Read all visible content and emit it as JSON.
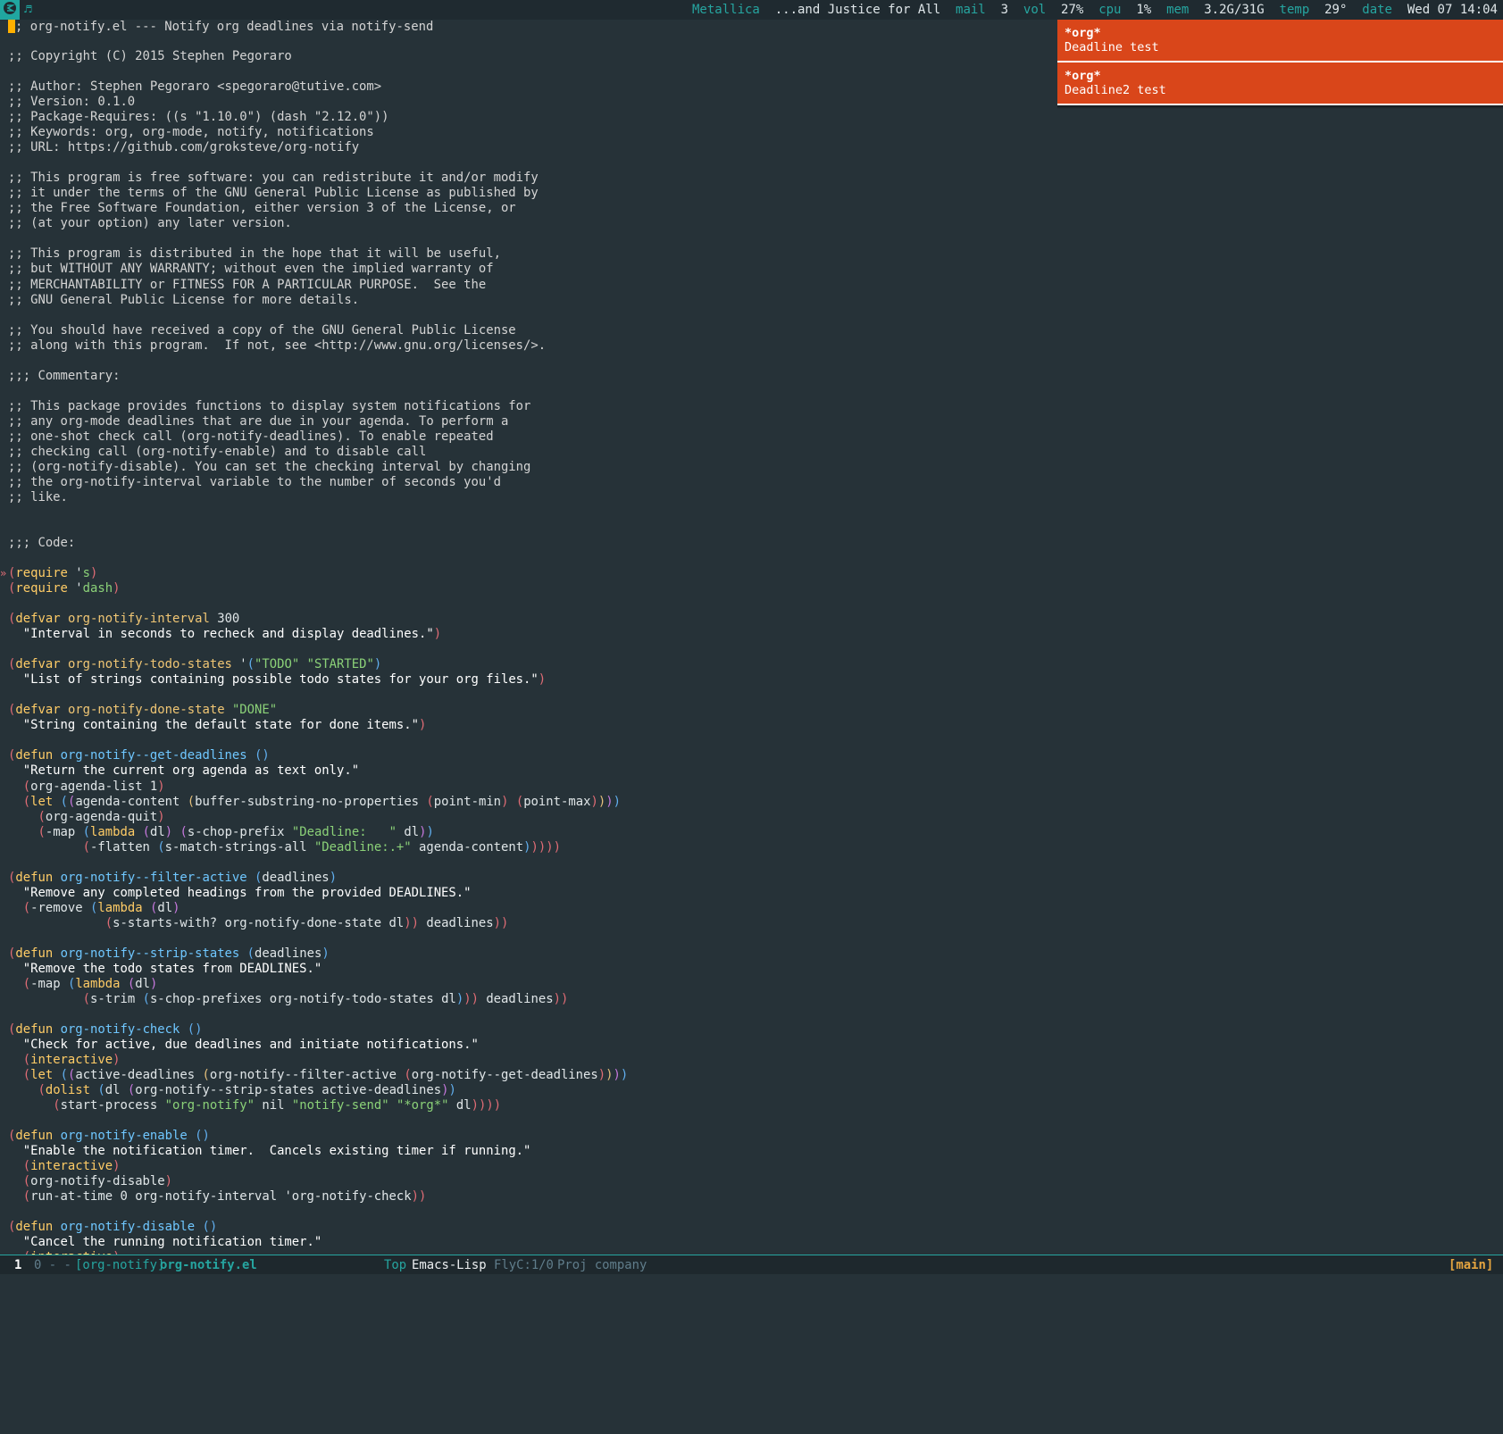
{
  "topbar": {
    "workspace_icon": "emacs-icon",
    "music_icon": "music-note-icon",
    "artist": "Metallica",
    "album": "...and Justice for All",
    "mail_label": "mail",
    "mail_value": "3",
    "vol_label": "vol",
    "vol_value": "27%",
    "cpu_label": "cpu",
    "cpu_value": "1%",
    "mem_label": "mem",
    "mem_value": "3.2G/31G",
    "temp_label": "temp",
    "temp_value": "29°",
    "date_label": "date",
    "date_value": "Wed 07 14:04"
  },
  "notifications": [
    {
      "title": "*org*",
      "body": "Deadline test"
    },
    {
      "title": "*org*",
      "body": "Deadline2 test"
    }
  ],
  "editor": {
    "lines": [
      ";; org-notify.el --- Notify org deadlines via notify-send",
      "",
      ";; Copyright (C) 2015 Stephen Pegoraro",
      "",
      ";; Author: Stephen Pegoraro <spegoraro@tutive.com>",
      ";; Version: 0.1.0",
      ";; Package-Requires: ((s \"1.10.0\") (dash \"2.12.0\"))",
      ";; Keywords: org, org-mode, notify, notifications",
      ";; URL: https://github.com/groksteve/org-notify",
      "",
      ";; This program is free software: you can redistribute it and/or modify",
      ";; it under the terms of the GNU General Public License as published by",
      ";; the Free Software Foundation, either version 3 of the License, or",
      ";; (at your option) any later version.",
      "",
      ";; This program is distributed in the hope that it will be useful,",
      ";; but WITHOUT ANY WARRANTY; without even the implied warranty of",
      ";; MERCHANTABILITY or FITNESS FOR A PARTICULAR PURPOSE.  See the",
      ";; GNU General Public License for more details.",
      "",
      ";; You should have received a copy of the GNU General Public License",
      ";; along with this program.  If not, see <http://www.gnu.org/licenses/>.",
      "",
      ";;; Commentary:",
      "",
      ";; This package provides functions to display system notifications for",
      ";; any org-mode deadlines that are due in your agenda. To perform a",
      ";; one-shot check call (org-notify-deadlines). To enable repeated",
      ";; checking call (org-notify-enable) and to disable call",
      ";; (org-notify-disable). You can set the checking interval by changing",
      ";; the org-notify-interval variable to the number of seconds you'd",
      ";; like.",
      "",
      "",
      ";;; Code:",
      "",
      "(require 's)",
      "(require 'dash)",
      "",
      "(defvar org-notify-interval 300",
      "  \"Interval in seconds to recheck and display deadlines.\")",
      "",
      "(defvar org-notify-todo-states '(\"TODO\" \"STARTED\")",
      "  \"List of strings containing possible todo states for your org files.\")",
      "",
      "(defvar org-notify-done-state \"DONE\"",
      "  \"String containing the default state for done items.\")",
      "",
      "(defun org-notify--get-deadlines ()",
      "  \"Return the current org agenda as text only.\"",
      "  (org-agenda-list 1)",
      "  (let ((agenda-content (buffer-substring-no-properties (point-min) (point-max))))",
      "    (org-agenda-quit)",
      "    (-map (lambda (dl) (s-chop-prefix \"Deadline:   \" dl))",
      "          (-flatten (s-match-strings-all \"Deadline:.+\" agenda-content)))))",
      "",
      "(defun org-notify--filter-active (deadlines)",
      "  \"Remove any completed headings from the provided DEADLINES.\"",
      "  (-remove (lambda (dl)",
      "             (s-starts-with? org-notify-done-state dl)) deadlines))",
      "",
      "(defun org-notify--strip-states (deadlines)",
      "  \"Remove the todo states from DEADLINES.\"",
      "  (-map (lambda (dl)",
      "          (s-trim (s-chop-prefixes org-notify-todo-states dl))) deadlines))",
      "",
      "(defun org-notify-check ()",
      "  \"Check for active, due deadlines and initiate notifications.\"",
      "  (interactive)",
      "  (let ((active-deadlines (org-notify--filter-active (org-notify--get-deadlines))))",
      "    (dolist (dl (org-notify--strip-states active-deadlines))",
      "      (start-process \"org-notify\" nil \"notify-send\" \"*org*\" dl))))",
      "",
      "(defun org-notify-enable ()",
      "  \"Enable the notification timer.  Cancels existing timer if running.\"",
      "  (interactive)",
      "  (org-notify-disable)",
      "  (run-at-time 0 org-notify-interval 'org-notify-check))",
      "",
      "(defun org-notify-disable ()",
      "  \"Cancel the running notification timer.\"",
      "  (interactive)"
    ]
  },
  "modeline": {
    "window_number": "1",
    "encoding_marker": "0 - -",
    "project": "[org-notify]",
    "filename": "org-notify.el",
    "position": "Top",
    "major_mode": "Emacs-Lisp",
    "flycheck": "FlyC:1/0",
    "minor_modes": "Proj company",
    "branch": "[main]"
  },
  "colors": {
    "background": "#263238",
    "accent": "#26a5a0",
    "notification": "#d9461a",
    "cursor": "#ffb000"
  }
}
